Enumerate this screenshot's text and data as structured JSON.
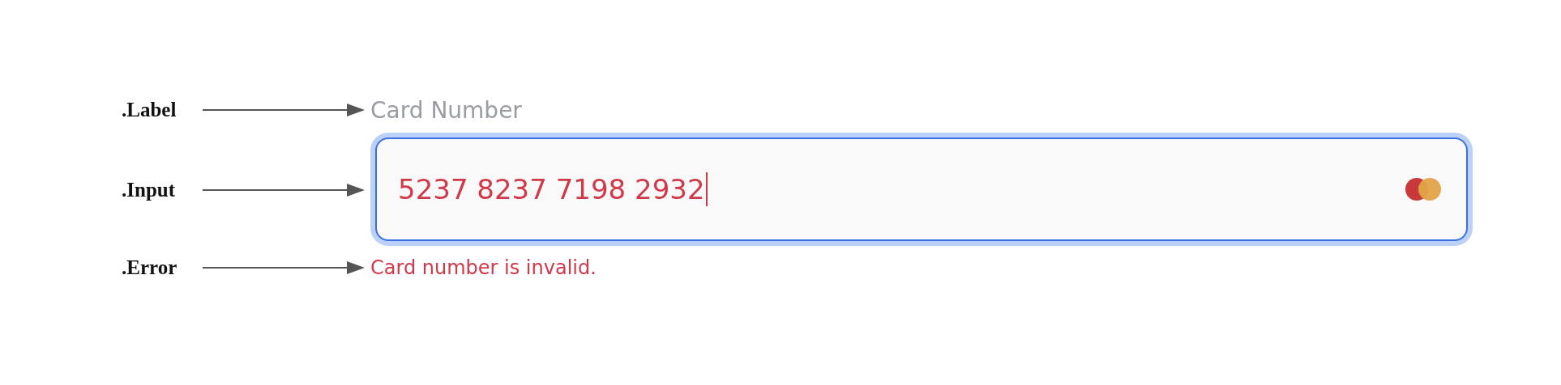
{
  "annotations": [
    {
      "text": ".Label"
    },
    {
      "text": ".Input"
    },
    {
      "text": ".Error"
    }
  ],
  "field": {
    "label": "Card Number",
    "value": "5237 8237 7198 2932",
    "focused": true,
    "error": "Card number is invalid."
  }
}
